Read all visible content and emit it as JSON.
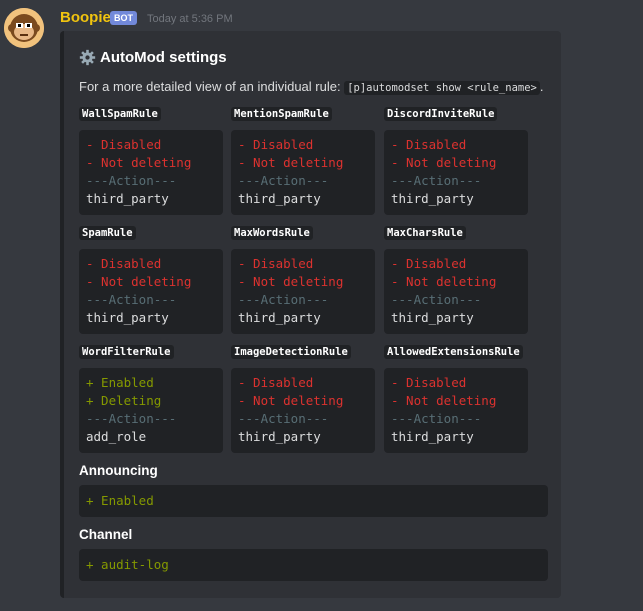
{
  "message": {
    "username": "Boopie",
    "badge": "BOT",
    "timestamp": "Today at 5:36 PM"
  },
  "embed": {
    "title": "AutoMod settings",
    "title_icon": "gear-icon",
    "desc_prefix": "For a more detailed view of an individual rule: ",
    "desc_code": "[p]automodset show <rule_name>",
    "desc_suffix": ".",
    "rules": [
      {
        "name": "WallSpamRule",
        "lines": [
          "- Disabled",
          "- Not deleting",
          "---Action---",
          "third_party"
        ],
        "state": "off"
      },
      {
        "name": "MentionSpamRule",
        "lines": [
          "- Disabled",
          "- Not deleting",
          "---Action---",
          "third_party"
        ],
        "state": "off"
      },
      {
        "name": "DiscordInviteRule",
        "lines": [
          "- Disabled",
          "- Not deleting",
          "---Action---",
          "third_party"
        ],
        "state": "off"
      },
      {
        "name": "SpamRule",
        "lines": [
          "- Disabled",
          "- Not deleting",
          "---Action---",
          "third_party"
        ],
        "state": "off"
      },
      {
        "name": "MaxWordsRule",
        "lines": [
          "- Disabled",
          "- Not deleting",
          "---Action---",
          "third_party"
        ],
        "state": "off"
      },
      {
        "name": "MaxCharsRule",
        "lines": [
          "- Disabled",
          "- Not deleting",
          "---Action---",
          "third_party"
        ],
        "state": "off"
      },
      {
        "name": "WordFilterRule",
        "lines": [
          "+ Enabled",
          "+ Deleting",
          "---Action---",
          "add_role"
        ],
        "state": "on"
      },
      {
        "name": "ImageDetectionRule",
        "lines": [
          "- Disabled",
          "- Not deleting",
          "---Action---",
          "third_party"
        ],
        "state": "off"
      },
      {
        "name": "AllowedExtensionsRule",
        "lines": [
          "- Disabled",
          "- Not deleting",
          "---Action---",
          "third_party"
        ],
        "state": "off"
      }
    ],
    "announcing": {
      "title": "Announcing",
      "value": "+ Enabled"
    },
    "channel": {
      "title": "Channel",
      "value": "+ audit-log"
    }
  },
  "colors": {
    "background": "#36393f",
    "embed": "#2f3136",
    "code": "#202225",
    "disabled": "#dc322f",
    "enabled": "#859900",
    "separator": "#586e75",
    "username": "#f1c40f",
    "badge": "#7289da"
  }
}
